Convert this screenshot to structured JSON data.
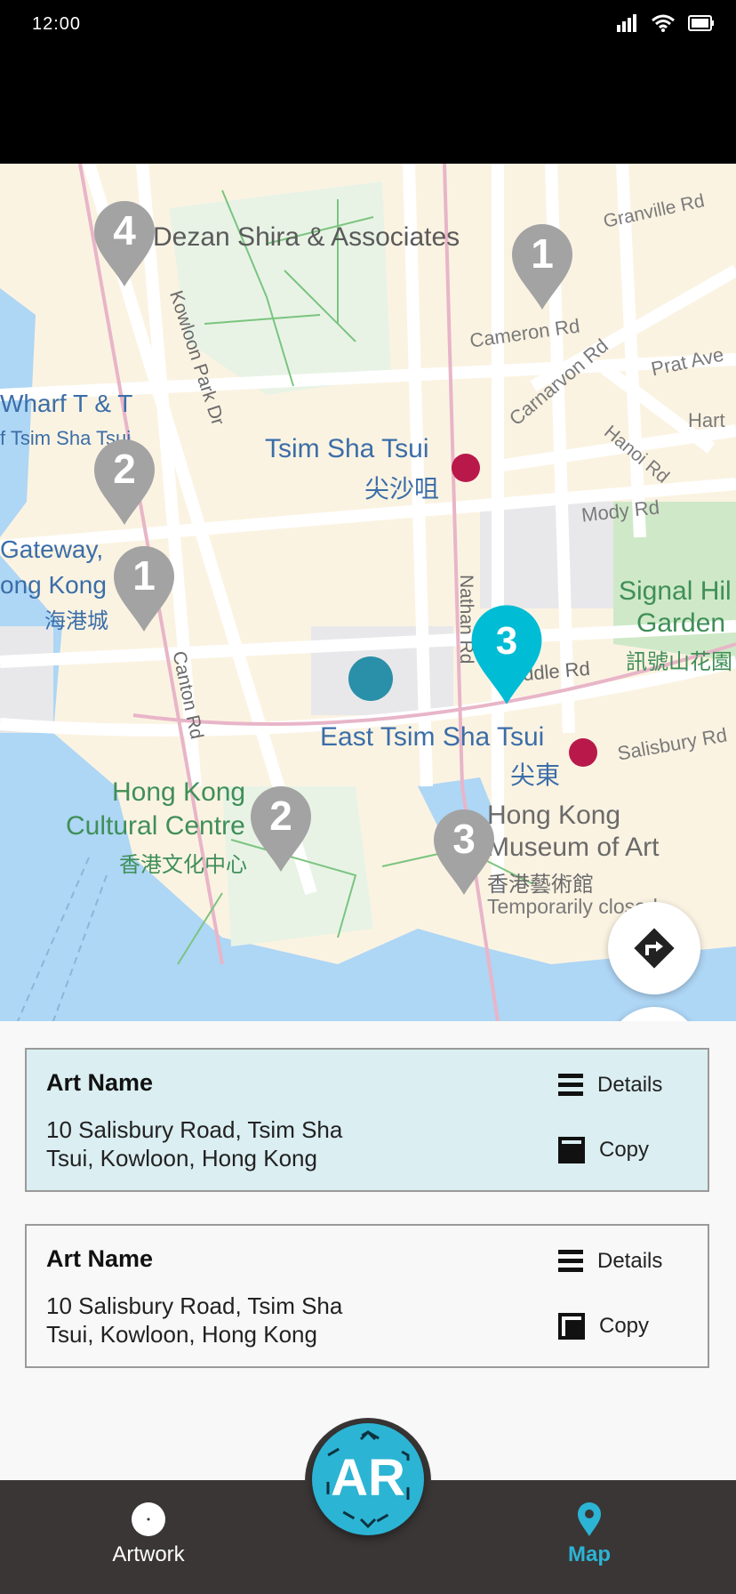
{
  "status_bar": {
    "time": "12:00"
  },
  "map": {
    "labels": {
      "dezan": "Dezan Shira & Associates",
      "granville": "Granville Rd",
      "cameron": "Cameron Rd",
      "prat": "Prat Ave",
      "hart": "Hart",
      "carnarvon": "Carnarvon Rd",
      "hanoi": "Hanoi Rd",
      "mody": "Mody Rd",
      "kowloon_park": "Kowloon Park Dr",
      "wharf1": "Wharf T & T",
      "wharf2": "f Tsim Sha Tsui",
      "tst_en": "Tsim Sha Tsui",
      "tst_zh": "尖沙咀",
      "gateway1": "Gateway,",
      "gateway2": "ong Kong",
      "gateway_zh": "海港城",
      "nathan": "Nathan Rd",
      "middle": "ddle Rd",
      "signal1": "Signal Hil",
      "signal2": "Garden",
      "signal_zh": "訊號山花園",
      "canton": "Canton Rd",
      "etst_en": "East Tsim Sha Tsui",
      "etst_zh": "尖東",
      "salisbury": "Salisbury Rd",
      "hkcc1": "Hong Kong",
      "hkcc2": "Cultural Centre",
      "hkcc_zh": "香港文化中心",
      "hkma1": "Hong Kong",
      "hkma2": "Museum of Art",
      "hkma_zh": "香港藝術館",
      "hkma_note": "Temporarily closed"
    },
    "pins": [
      "4",
      "1",
      "2",
      "1",
      "3",
      "2",
      "3"
    ],
    "colors": {
      "pin_grey": "#a3a3a3",
      "pin_active": "#00bcd4",
      "user_dot": "#2a8fa8"
    }
  },
  "cards": [
    {
      "title": "Art Name",
      "address": "10 Salisbury Road, Tsim Sha Tsui, Kowloon, Hong Kong",
      "details_label": "Details",
      "copy_label": "Copy",
      "selected": true
    },
    {
      "title": "Art Name",
      "address": "10 Salisbury Road, Tsim Sha Tsui, Kowloon, Hong Kong",
      "details_label": "Details",
      "copy_label": "Copy",
      "selected": false
    }
  ],
  "bottom_nav": {
    "ar_label": "AR",
    "items": [
      {
        "label": "Artwork",
        "icon": "artwork-icon"
      },
      {
        "label": "Map",
        "icon": "map-pin-icon",
        "active": true
      }
    ],
    "accent": "#2cb4d4"
  }
}
